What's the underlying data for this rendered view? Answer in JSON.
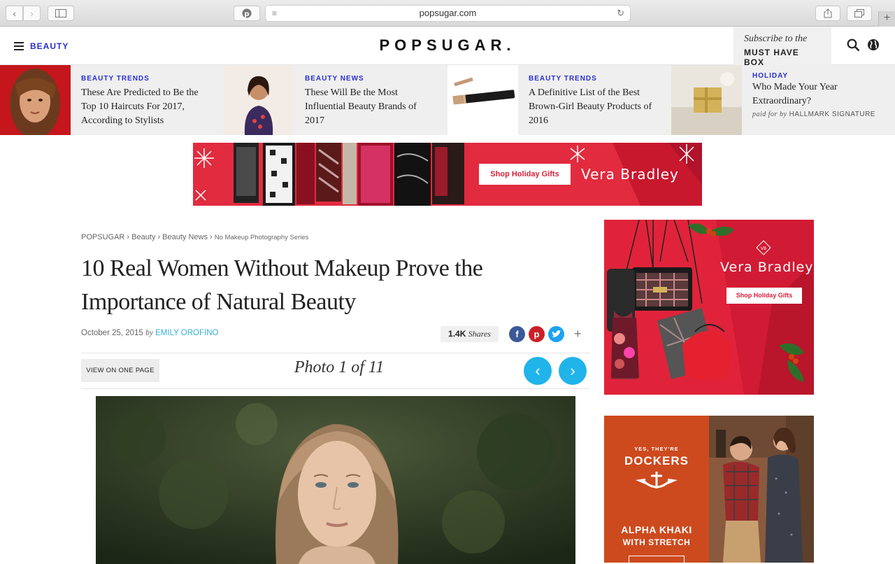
{
  "browser": {
    "url": "popsugar.com"
  },
  "header": {
    "section_label": "BEAUTY",
    "logo": "POPSUGAR.",
    "subscribe_line1": "Subscribe to the",
    "subscribe_line2": "MUST HAVE BOX"
  },
  "trending": [
    {
      "category": "BEAUTY TRENDS",
      "title": "These Are Predicted to Be the Top 10 Haircuts For 2017, According to Stylists"
    },
    {
      "category": "BEAUTY NEWS",
      "title": "These Will Be the Most Influential Beauty Brands of 2017"
    },
    {
      "category": "BEAUTY TRENDS",
      "title": "A Definitive List of the Best Brown-Girl Beauty Products of 2016"
    },
    {
      "category": "HOLIDAY",
      "title": "Who Made Your Year Extraordinary?",
      "sponsor_prefix": "paid for by",
      "sponsor": "HALLMARK SIGNATURE"
    }
  ],
  "ads": {
    "top_button": "Shop Holiday Gifts",
    "top_brand": "Vera Bradley",
    "side_brand": "Vera Bradley",
    "side_button": "Shop Holiday Gifts",
    "dockers_tag": "YES, THEY'RE",
    "dockers_brand": "DOCKERS",
    "dockers_line1": "ALPHA KHAKI",
    "dockers_line2": "WITH STRETCH"
  },
  "article": {
    "breadcrumb": [
      "POPSUGAR",
      "Beauty",
      "Beauty News",
      "No Makeup Photography Series"
    ],
    "title": "10 Real Women Without Makeup Prove the Importance of Natural Beauty",
    "date": "October 25, 2015",
    "by": "by",
    "author": "EMILY OROFINO",
    "shares_count": "1.4K",
    "shares_label": "Shares",
    "view_one_page": "VIEW ON ONE PAGE",
    "photo_counter": "Photo 1 of 11"
  },
  "icons": {
    "menu": "hamburger-icon",
    "search": "search-icon",
    "globe": "globe-icon",
    "prev": "chevron-left-icon",
    "next": "chevron-right-icon"
  },
  "colors": {
    "brand_blue": "#2a2ed0",
    "accent_cyan": "#20b4ea",
    "vera_red": "#e22b3f",
    "dockers_orange": "#cd4a1e",
    "facebook": "#3b5998",
    "pinterest": "#cb2027",
    "twitter": "#1da1f2"
  }
}
